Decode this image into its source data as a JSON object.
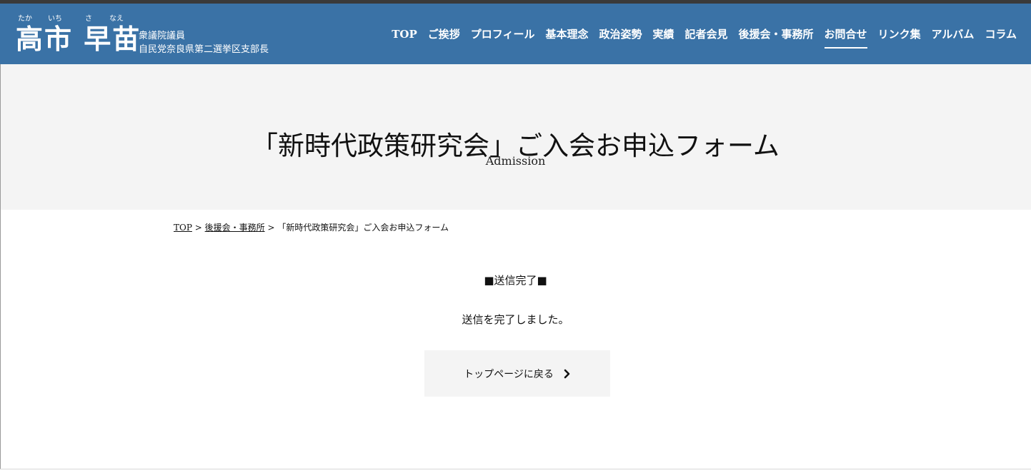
{
  "header": {
    "ruby": [
      "たか",
      "いち",
      "さ",
      "なえ"
    ],
    "name": "高市 早苗",
    "subtitle_line1": "衆議院議員",
    "subtitle_line2": "自民党奈良県第二選挙区支部長"
  },
  "nav": {
    "items": [
      {
        "label": "TOP"
      },
      {
        "label": "ご挨拶"
      },
      {
        "label": "プロフィール"
      },
      {
        "label": "基本理念"
      },
      {
        "label": "政治姿勢"
      },
      {
        "label": "実績"
      },
      {
        "label": "記者会見"
      },
      {
        "label": "後援会・事務所"
      },
      {
        "label": "お問合せ",
        "active": true
      },
      {
        "label": "リンク集"
      },
      {
        "label": "アルバム"
      },
      {
        "label": "コラム"
      }
    ]
  },
  "hero": {
    "title": "「新時代政策研究会」ご入会お申込フォーム",
    "subtitle": "Admission"
  },
  "breadcrumb": {
    "home": "TOP",
    "sep1": " > ",
    "parent": "後援会・事務所",
    "sep2": " > ",
    "current": "「新時代政策研究会」ご入会お申込フォーム"
  },
  "status": {
    "heading": "■送信完了■",
    "message": "送信を完了しました。"
  },
  "back_button": {
    "label": "トップページに戻る",
    "icon": "chevron-right-icon"
  },
  "colors": {
    "header_bg": "#3a72a6",
    "hero_bg": "#f4f4f4",
    "button_bg": "#f4f4f4"
  }
}
